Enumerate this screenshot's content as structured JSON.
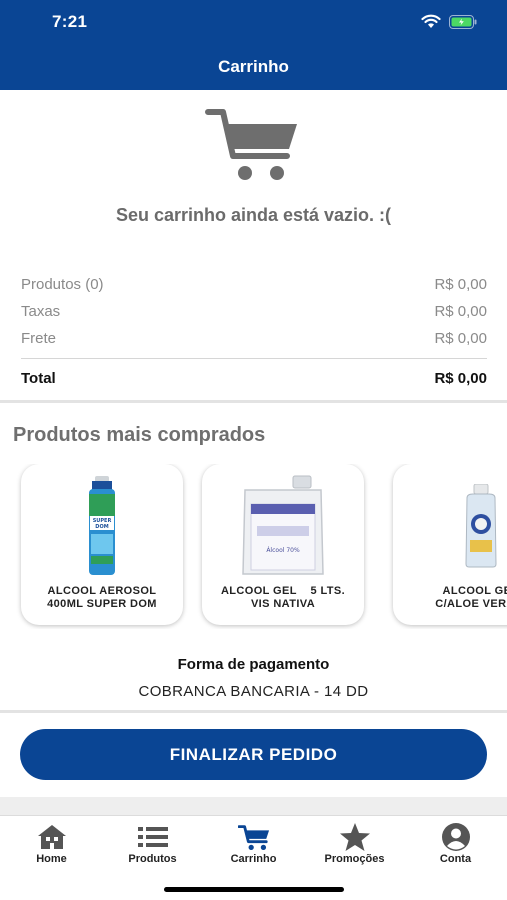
{
  "status_bar": {
    "time": "7:21"
  },
  "header": {
    "title": "Carrinho"
  },
  "cart": {
    "empty_message": "Seu carrinho ainda está vazio. :("
  },
  "summary": {
    "rows": [
      {
        "label": "Produtos (0)",
        "value": "R$ 0,00"
      },
      {
        "label": "Taxas",
        "value": "R$ 0,00"
      },
      {
        "label": "Frete",
        "value": "R$ 0,00"
      }
    ],
    "total_label": "Total",
    "total_value": "R$ 0,00"
  },
  "top_products": {
    "title": "Produtos mais comprados",
    "items": [
      {
        "name_line1": "ALCOOL AEROSOL",
        "name_line2": "400ML SUPER DOM",
        "label_text": "SUPER DOM"
      },
      {
        "name_line1": "ALCOOL GEL    5 LTS.",
        "name_line2": "VIS NATIVA",
        "label_text": "Álcool 70%"
      },
      {
        "name_line1": "ALCOOL GEL",
        "name_line2": "C/ALOE VERA A"
      }
    ]
  },
  "payment": {
    "label": "Forma de pagamento",
    "value": "COBRANCA BANCARIA - 14 DD"
  },
  "checkout": {
    "button_label": "FINALIZAR PEDIDO"
  },
  "tabs": [
    {
      "label": "Home",
      "icon": "home-icon"
    },
    {
      "label": "Produtos",
      "icon": "list-icon"
    },
    {
      "label": "Carrinho",
      "icon": "cart-icon",
      "active": true
    },
    {
      "label": "Promoções",
      "icon": "star-icon"
    },
    {
      "label": "Conta",
      "icon": "user-icon"
    }
  ],
  "colors": {
    "brand_blue": "#0a4594",
    "battery_green": "#4cd964",
    "text_gray": "#6b6b6b"
  }
}
